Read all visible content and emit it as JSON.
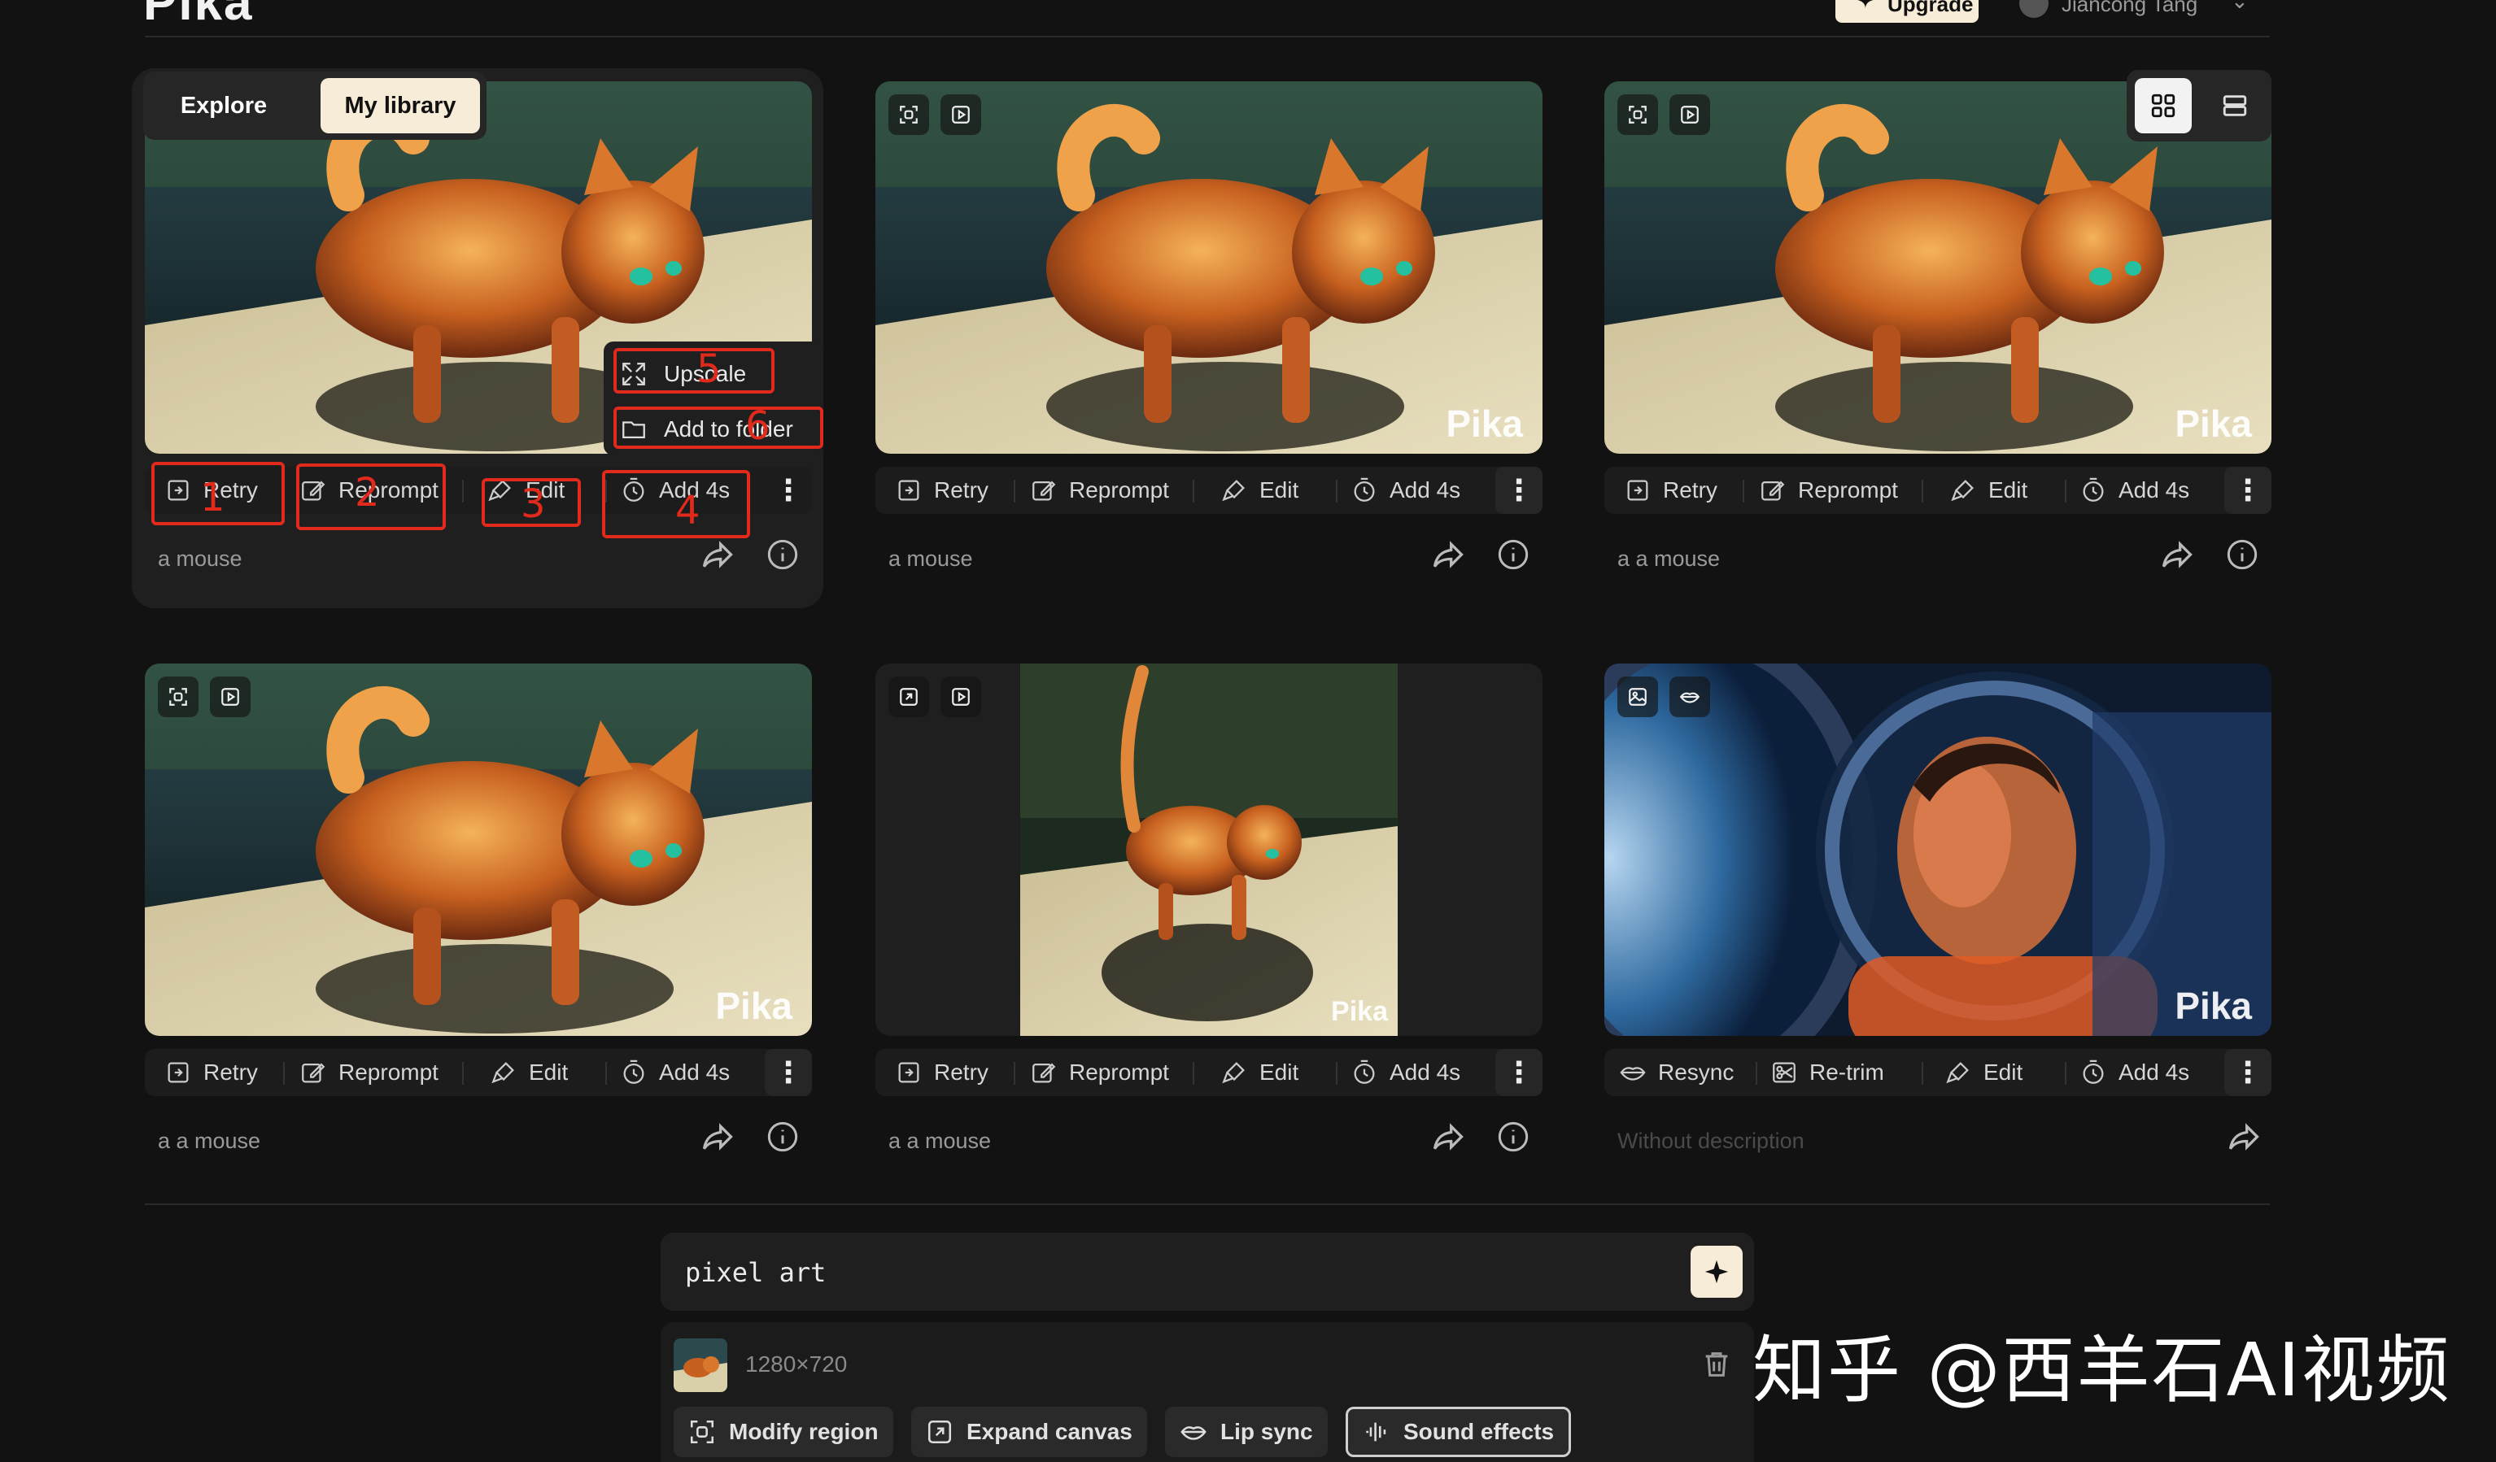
{
  "app": {
    "logo": "Pika"
  },
  "header": {
    "upgrade_label": "Upgrade",
    "user_name": "Jiancong Tang"
  },
  "tabs": {
    "explore": "Explore",
    "my_library": "My library"
  },
  "view_toggle": {
    "selected": "grid"
  },
  "dropdown": {
    "upscale": "Upscale",
    "add_to_folder": "Add to folder"
  },
  "annotations": [
    "1",
    "2",
    "3",
    "4",
    "5",
    "6"
  ],
  "cards": [
    {
      "watermark": "",
      "actions": [
        "Retry",
        "Reprompt",
        "Edit",
        "Add 4s"
      ],
      "caption": "a mouse"
    },
    {
      "watermark": "Pika",
      "actions": [
        "Retry",
        "Reprompt",
        "Edit",
        "Add 4s"
      ],
      "caption": "a mouse"
    },
    {
      "watermark": "Pika",
      "actions": [
        "Retry",
        "Reprompt",
        "Edit",
        "Add 4s"
      ],
      "caption": "a a mouse"
    },
    {
      "watermark": "Pika",
      "actions": [
        "Retry",
        "Reprompt",
        "Edit",
        "Add 4s"
      ],
      "caption": "a a mouse"
    },
    {
      "watermark": "Pika",
      "actions": [
        "Retry",
        "Reprompt",
        "Edit",
        "Add 4s"
      ],
      "caption": "a a mouse"
    },
    {
      "watermark": "Pika",
      "actions": [
        "Resync",
        "Re-trim",
        "Edit",
        "Add 4s"
      ],
      "caption": "Without description"
    }
  ],
  "prompt": {
    "text": "pixel art",
    "resolution": "1280×720",
    "chips": [
      "Modify region",
      "Expand canvas",
      "Lip sync",
      "Sound effects"
    ]
  },
  "overlay_watermark": "知乎 @西羊石AI视频",
  "colors": {
    "accent": "#f7ecd7",
    "annotation": "#e12a1c",
    "background": "#121212"
  }
}
